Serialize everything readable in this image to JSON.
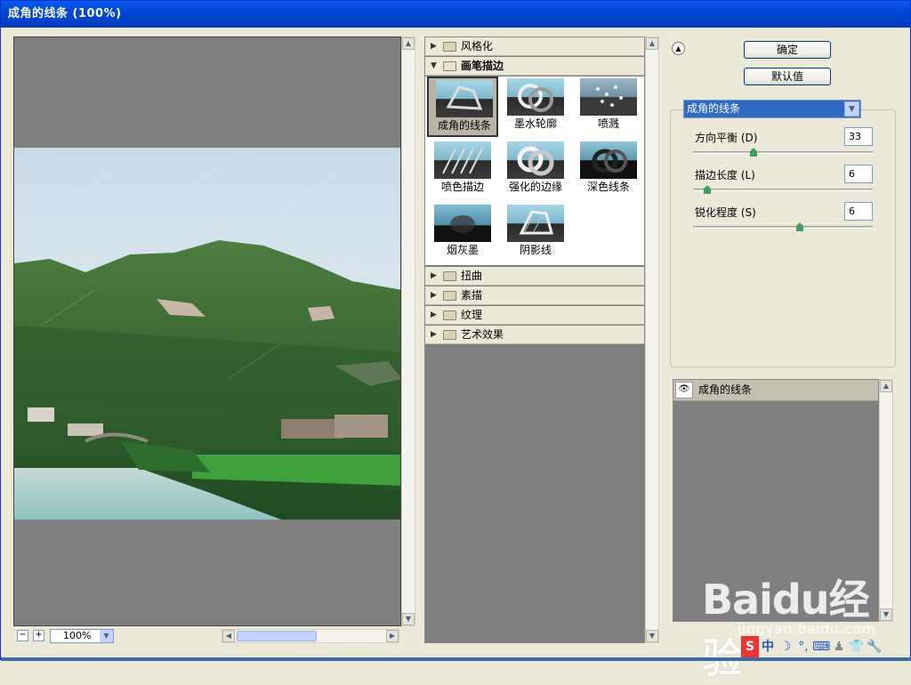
{
  "window": {
    "title": "成角的线条 (100%)"
  },
  "preview": {
    "zoom": "100%",
    "zoom_out": "−",
    "zoom_in": "+"
  },
  "categories_top": [
    {
      "label": "风格化",
      "expanded": false
    }
  ],
  "category_open": {
    "label": "画笔描边",
    "expanded": true
  },
  "thumbnails": [
    {
      "label": "成角的线条",
      "selected": true
    },
    {
      "label": "墨水轮廓",
      "selected": false
    },
    {
      "label": "喷溅",
      "selected": false
    },
    {
      "label": "喷色描边",
      "selected": false
    },
    {
      "label": "强化的边缘",
      "selected": false
    },
    {
      "label": "深色线条",
      "selected": false
    },
    {
      "label": "烟灰墨",
      "selected": false
    },
    {
      "label": "阴影线",
      "selected": false
    }
  ],
  "categories_bottom": [
    {
      "label": "扭曲"
    },
    {
      "label": "素描"
    },
    {
      "label": "纹理"
    },
    {
      "label": "艺术效果"
    }
  ],
  "buttons": {
    "ok": "确定",
    "default": "默认值"
  },
  "filter_select": {
    "value": "成角的线条"
  },
  "params": [
    {
      "label": "方向平衡 (D)",
      "value": "33",
      "level": 0.33
    },
    {
      "label": "描边长度 (L)",
      "value": "6",
      "level": 0.06
    },
    {
      "label": "锐化程度 (S)",
      "value": "6",
      "level": 0.6
    }
  ],
  "layers": [
    {
      "label": "成角的线条",
      "visible": true
    }
  ],
  "watermark": {
    "brand": "Bai",
    "brand2": "du",
    "brand3": "经验",
    "url": "jingyan.baidu.com"
  },
  "tray": {
    "ime": "中",
    "items": [
      "S",
      "中",
      "☽",
      "°,",
      "⌨",
      "♟",
      "👕",
      "🔧"
    ]
  }
}
